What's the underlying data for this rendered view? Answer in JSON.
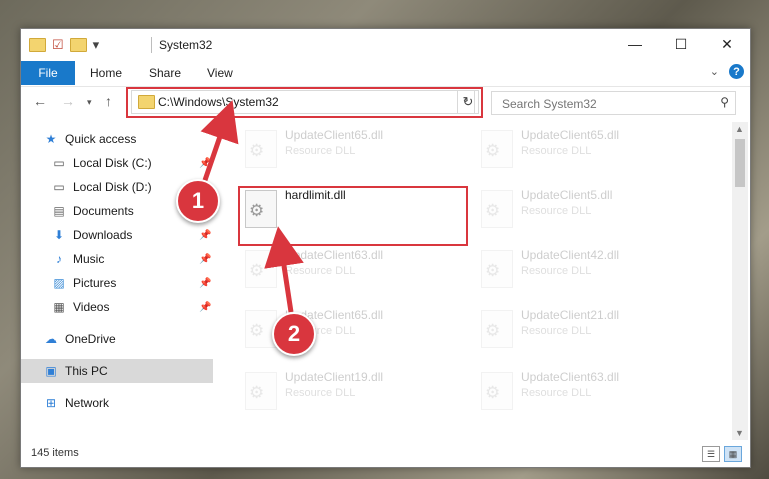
{
  "window": {
    "title": "System32",
    "minimize_glyph": "—",
    "maximize_glyph": "☐",
    "close_glyph": "✕"
  },
  "ribbon": {
    "file_tab": "File",
    "home_tab": "Home",
    "share_tab": "Share",
    "view_tab": "View",
    "expand_glyph": "⌄",
    "help_glyph": "?"
  },
  "address_bar": {
    "path": "C:\\Windows\\System32",
    "search_placeholder": "Search System32"
  },
  "sidebar": {
    "items": [
      {
        "label": "Quick access",
        "icon": "star-icon"
      },
      {
        "label": "Local Disk (C:)",
        "icon": "drive-icon"
      },
      {
        "label": "Local Disk (D:)",
        "icon": "drive-icon"
      },
      {
        "label": "Documents",
        "icon": "documents-icon"
      },
      {
        "label": "Downloads",
        "icon": "download-icon"
      },
      {
        "label": "Music",
        "icon": "music-icon"
      },
      {
        "label": "Pictures",
        "icon": "pictures-icon"
      },
      {
        "label": "Videos",
        "icon": "videos-icon"
      },
      {
        "label": "OneDrive",
        "icon": "cloud-icon"
      },
      {
        "label": "This PC",
        "icon": "computer-icon"
      },
      {
        "label": "Network",
        "icon": "network-icon"
      }
    ]
  },
  "files": [
    {
      "name": "UpdateClient65.dll",
      "type": "Resource DLL"
    },
    {
      "name": "UpdateClient65.dll",
      "type": "Resource DLL"
    },
    {
      "name": "hardlimit.dll",
      "type": ""
    },
    {
      "name": "UpdateClient5.dll",
      "type": "Resource DLL"
    },
    {
      "name": "UpdateClient63.dll",
      "type": "Resource DLL"
    },
    {
      "name": "UpdateClient42.dll",
      "type": "Resource DLL"
    },
    {
      "name": "UpdateClient65.dll",
      "type": "Resource DLL"
    },
    {
      "name": "UpdateClient21.dll",
      "type": "Resource DLL"
    },
    {
      "name": "UpdateClient19.dll",
      "type": "Resource DLL"
    },
    {
      "name": "UpdateClient63.dll",
      "type": "Resource DLL"
    }
  ],
  "status_bar": {
    "items_count": "145 items"
  },
  "callouts": {
    "one": "1",
    "two": "2"
  },
  "colors": {
    "accent": "#1979ca",
    "highlight": "#d9363e"
  }
}
